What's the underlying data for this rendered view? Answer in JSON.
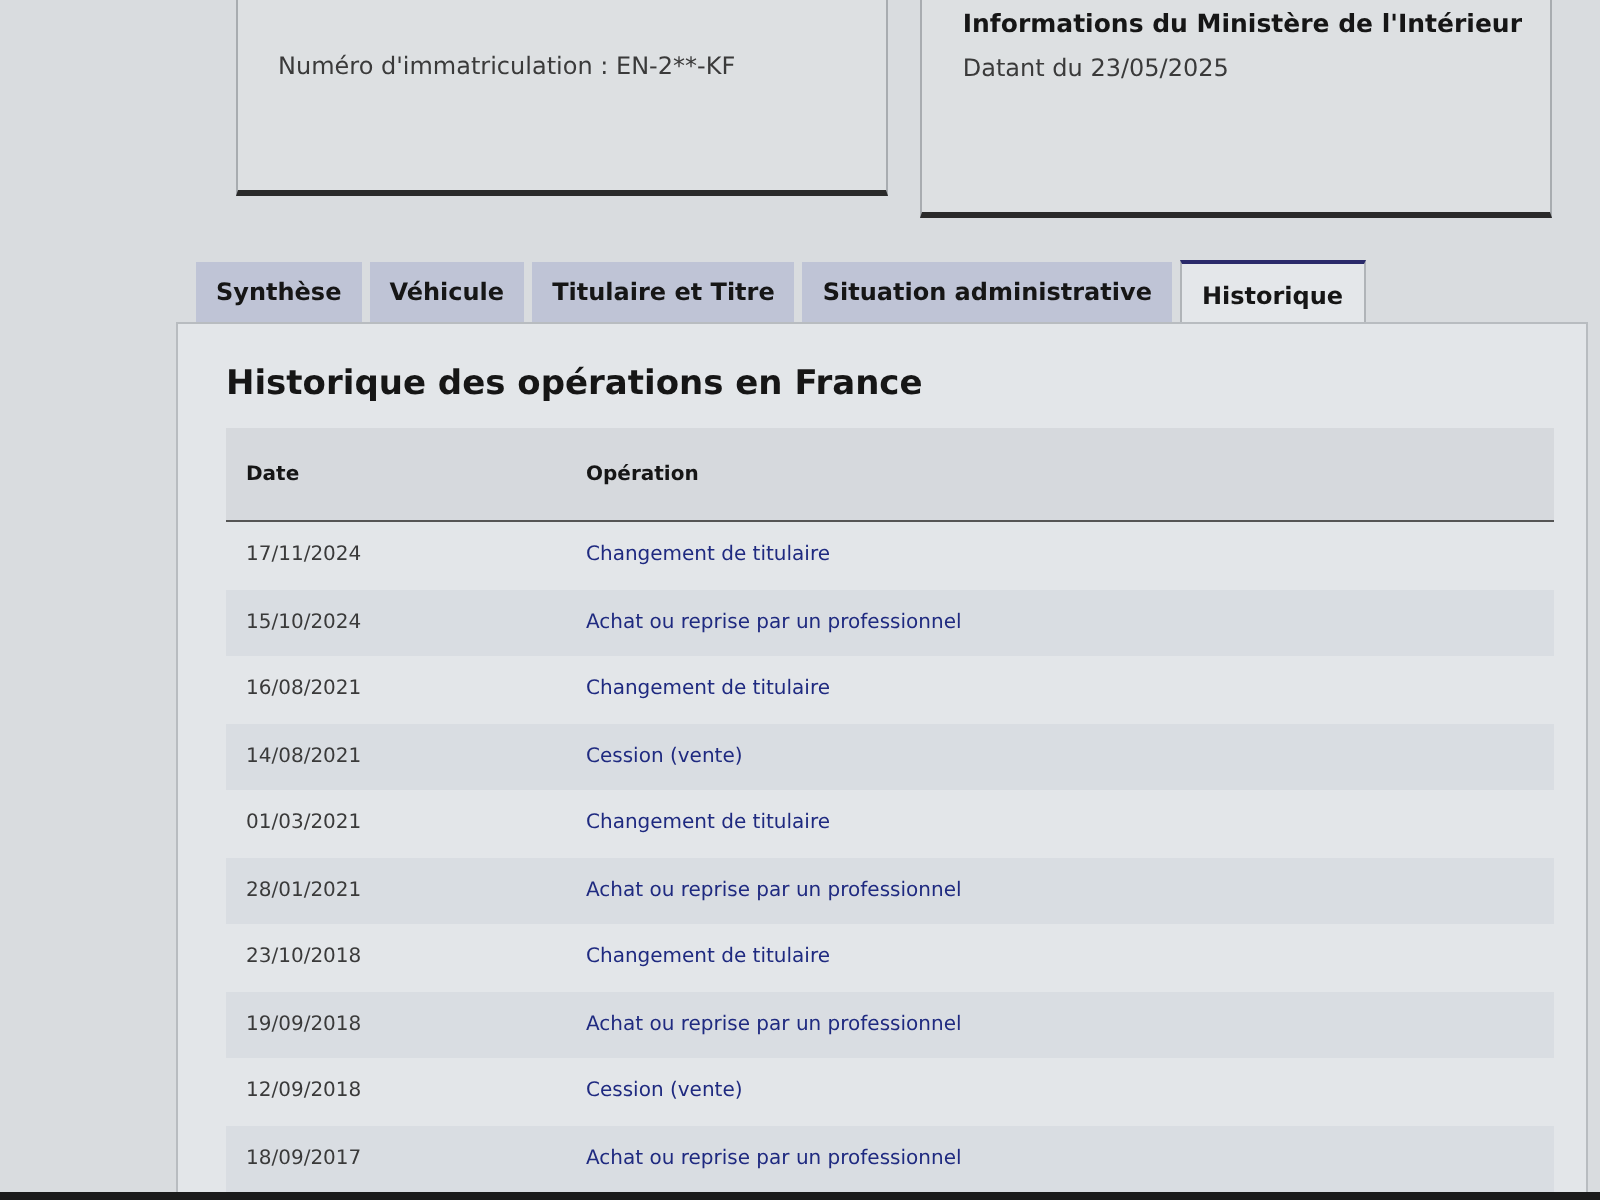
{
  "cards": [
    {
      "text": "Numéro d'immatriculation : EN-2**-KF"
    },
    {
      "title": "Informations du Ministère de l'Intérieur",
      "text": "Datant du 23/05/2025"
    }
  ],
  "tabs": [
    {
      "label": "Synthèse",
      "selected": false
    },
    {
      "label": "Véhicule",
      "selected": false
    },
    {
      "label": "Titulaire et Titre",
      "selected": false
    },
    {
      "label": "Situation administrative",
      "selected": false
    },
    {
      "label": "Historique",
      "selected": true
    }
  ],
  "section_title": "Historique des opérations en France",
  "table": {
    "columns": [
      "Date",
      "Opération"
    ],
    "rows": [
      [
        "17/11/2024",
        "Changement de titulaire"
      ],
      [
        "15/10/2024",
        "Achat ou reprise par un professionnel"
      ],
      [
        "16/08/2021",
        "Changement de titulaire"
      ],
      [
        "14/08/2021",
        "Cession (vente)"
      ],
      [
        "01/03/2021",
        "Changement de titulaire"
      ],
      [
        "28/01/2021",
        "Achat ou reprise par un professionnel"
      ],
      [
        "23/10/2018",
        "Changement de titulaire"
      ],
      [
        "19/09/2018",
        "Achat ou reprise par un professionnel"
      ],
      [
        "12/09/2018",
        "Cession (vente)"
      ],
      [
        "18/09/2017",
        "Achat ou reprise par un professionnel"
      ]
    ]
  }
}
